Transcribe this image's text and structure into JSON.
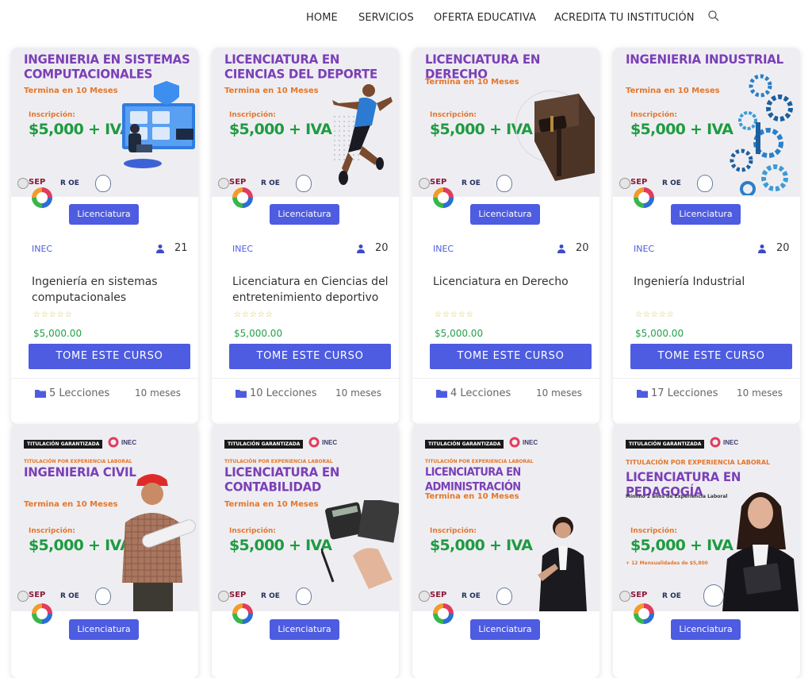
{
  "nav": {
    "items": [
      "HOME",
      "SERVICIOS",
      "OFERTA EDUCATIVA",
      "ACREDITA TU INSTITUCIÓN"
    ],
    "search_icon": "search-icon"
  },
  "common": {
    "termina": "Termina en 10 Meses",
    "inscripcion": "Inscripción:",
    "price_big": "$5,000 + IVA",
    "badge": "Licenciatura",
    "institution": "INEC",
    "take_course": "TOME ESTE CURSO",
    "rating_stars": "☆☆☆☆☆",
    "sep": "SEP",
    "rvoe": "R OE",
    "tag_garantizada": "TITULACIÓN GARANTIZADA",
    "tag_experiencia": "TITULACIÓN POR EXPERIENCIA LABORAL",
    "inec_logo": "INEC",
    "minimo": "Mínimo 2 años de Experiencia Laboral",
    "mensualidades": "+ 12 Mensualidades de $5,800"
  },
  "courses_row1": [
    {
      "thumb_title": "INGENIERIA EN SISTEMAS COMPUTACIONALES",
      "name": "Ingeniería en sistemas computacionales",
      "students": "21",
      "price": "$5,000.00",
      "lessons": "5 Lecciones",
      "duration": "10 meses"
    },
    {
      "thumb_title": "LICENCIATURA EN CIENCIAS DEL DEPORTE",
      "name": "Licenciatura en Ciencias del entretenimiento deportivo",
      "students": "20",
      "price": "$5,000.00",
      "lessons": "10 Lecciones",
      "duration": "10 meses"
    },
    {
      "thumb_title": "LICENCIATURA EN DERECHO",
      "name": "Licenciatura en Derecho",
      "students": "20",
      "price": "$5,000.00",
      "lessons": "4 Lecciones",
      "duration": "10 meses"
    },
    {
      "thumb_title": "INGENIERIA INDUSTRIAL",
      "name": "Ingeniería Industrial",
      "students": "20",
      "price": "$5,000.00",
      "lessons": "17 Lecciones",
      "duration": "10 meses"
    }
  ],
  "courses_row2": [
    {
      "thumb_title": "INGENIERIA CIVIL"
    },
    {
      "thumb_title": "LICENCIATURA EN CONTABILIDAD"
    },
    {
      "thumb_title": "LICENCIATURA EN ADMINISTRACIÓN"
    },
    {
      "thumb_title": "LICENCIATURA EN PEDAGOGÍA"
    }
  ],
  "colors": {
    "accent": "#4d5ce0",
    "title_purple": "#7b3fb7",
    "orange": "#e4762b",
    "green": "#1f9b41"
  }
}
